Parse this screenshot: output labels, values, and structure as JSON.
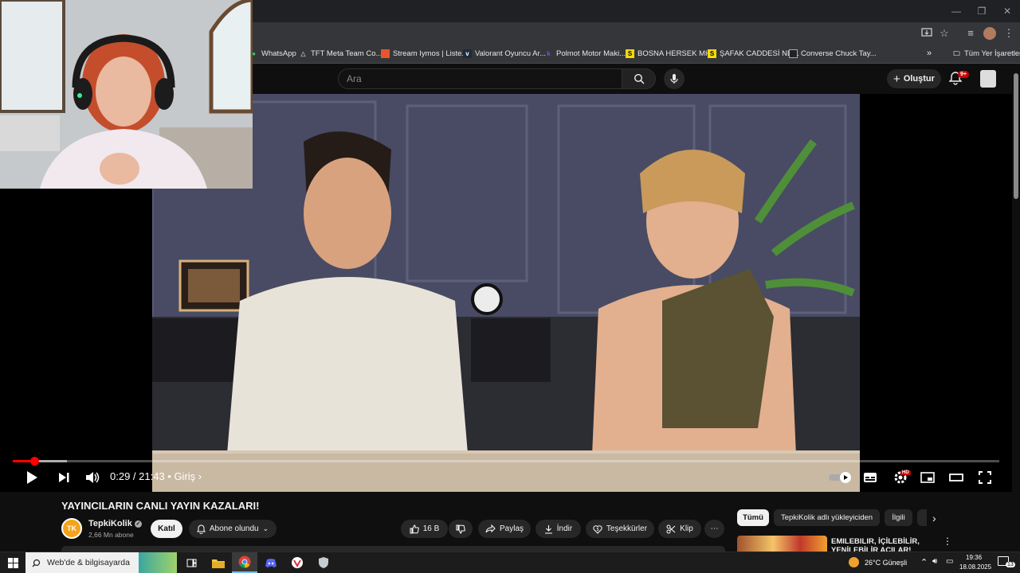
{
  "browser": {
    "bookmarks": [
      {
        "label": "WhatsApp",
        "icon": "whatsapp-icon",
        "color": "#25d366"
      },
      {
        "label": "TFT Meta Team Co...",
        "icon": "tft-icon",
        "color": "#aaaaaa"
      },
      {
        "label": "Stream Iymos | Liste...",
        "icon": "stream-icon",
        "color": "#e8552d"
      },
      {
        "label": "Valorant Oyuncu Ar...",
        "icon": "valorant-icon",
        "color": "#ffffff"
      },
      {
        "label": "Polmot Motor Maki...",
        "icon": "k-icon",
        "color": "#8a3ffc"
      },
      {
        "label": "BOSNA HERSEK MH...",
        "icon": "s-icon",
        "color": "#f5d90a"
      },
      {
        "label": "ŞAFAK CADDESİ ND...",
        "icon": "s-icon",
        "color": "#f5d90a"
      },
      {
        "label": "Converse Chuck Tay...",
        "icon": "converse-icon",
        "color": "#ffffff"
      }
    ],
    "all_bookmarks_label": "Tüm Yer İşaretleri",
    "overflow": "»"
  },
  "masthead": {
    "search_placeholder": "Ara",
    "create_label": "Oluştur",
    "notif_badge": "9+"
  },
  "player": {
    "current_time": "0:29",
    "duration": "21:43",
    "chapter": "Giriş",
    "time_text": "0:29 / 21:43  •  Giriş ›",
    "progress_fraction": 0.022,
    "buffer_fraction": 0.055,
    "hd_badge": "HD"
  },
  "video": {
    "title": "YAYINCILARIN CANLI YAYIN KAZALARI!",
    "channel_name": "TepkiKolik",
    "channel_avatar_text": "TK",
    "subscribers": "2,66 Mn abone",
    "join_label": "Katıl",
    "subscribed_label": "Abone olundu",
    "likes": "16 B",
    "share_label": "Paylaş",
    "download_label": "İndir",
    "thanks_label": "Teşekkürler",
    "clip_label": "Klip",
    "more": "⋯"
  },
  "recommendations": {
    "chips": [
      "Tümü",
      "TepkiKolik adlı yükleyiciden",
      "İlgili"
    ],
    "first_title": "EMILEBILIR, İÇİLEBİLİR, YENİLEBİLİR AÇILAR!"
  },
  "taskbar": {
    "search_text": "Web'de & bilgisayarda",
    "weather": "26°C  Güneşli",
    "time": "19:36",
    "date": "18.08.2025",
    "notif_count": "13"
  }
}
